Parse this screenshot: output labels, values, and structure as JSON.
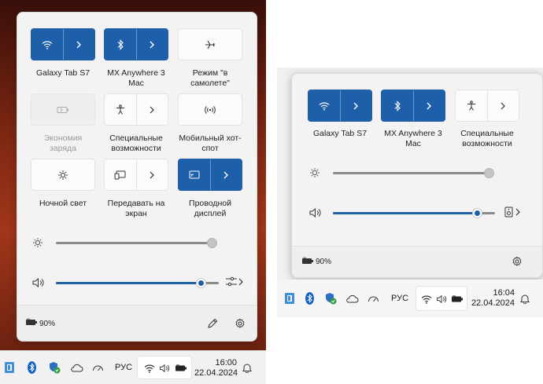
{
  "left": {
    "tiles": [
      {
        "label": "Galaxy Tab S7",
        "icon": "wifi-icon",
        "state": "on",
        "split": true
      },
      {
        "label": "MX Anywhere 3\nMac",
        "icon": "bluetooth-icon",
        "state": "on",
        "split": true
      },
      {
        "label": "Режим \"в\nсамолете\"",
        "icon": "airplane-icon",
        "state": "off",
        "split": false
      },
      {
        "label": "Экономия\nзаряда",
        "icon": "battery-saver-icon",
        "state": "disabled",
        "split": false
      },
      {
        "label": "Специальные\nвозможности",
        "icon": "accessibility-icon",
        "state": "off",
        "split": true
      },
      {
        "label": "Мобильный хот-\nспот",
        "icon": "hotspot-icon",
        "state": "off",
        "split": false
      },
      {
        "label": "Ночной свет",
        "icon": "night-light-icon",
        "state": "off",
        "split": false
      },
      {
        "label": "Передавать на\nэкран",
        "icon": "cast-icon",
        "state": "off",
        "split": true
      },
      {
        "label": "Проводной\nдисплей",
        "icon": "wired-display-icon",
        "state": "on",
        "split": true
      }
    ],
    "brightness": 1.0,
    "volume": 0.89,
    "battery_percent": "90%",
    "clock_time": "16:00",
    "clock_date": "22.04.2024",
    "lang": "РУС"
  },
  "right": {
    "tiles": [
      {
        "label": "Galaxy Tab S7",
        "icon": "wifi-icon",
        "state": "on",
        "split": true
      },
      {
        "label": "MX Anywhere 3\nMac",
        "icon": "bluetooth-icon",
        "state": "on",
        "split": true
      },
      {
        "label": "Специальные\nвозможности",
        "icon": "accessibility-icon",
        "state": "off",
        "split": true
      }
    ],
    "brightness": 1.0,
    "volume": 0.89,
    "battery_percent": "90%",
    "clock_time": "16:04",
    "clock_date": "22.04.2024",
    "lang": "РУС"
  },
  "colors": {
    "accent": "#1e5fa9"
  }
}
